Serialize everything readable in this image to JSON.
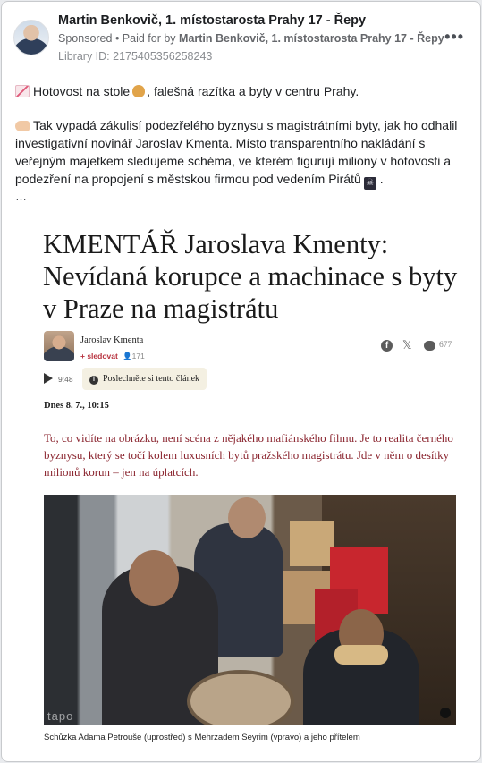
{
  "post": {
    "page_name": "Martin Benkovič, 1. místostarosta Prahy 17 - Řepy",
    "sponsored_label": "Sponsored",
    "separator": " • ",
    "paid_for_prefix": "Paid for by ",
    "paid_for_name": "Martin Benkovič, 1. místostarosta Prahy 17 - Řepy",
    "library_id": "Library ID: 2175405356258243",
    "more_icon": "•••",
    "text_p1_a": "Hotovost na stole",
    "text_p1_b": ", falešná razítka a byty v centru Prahy.",
    "text_p2_a": "Tak vypadá zákulisí podezřelého byznysu s magistrátními byty, jak ho odhalil investigativní novinář Jaroslav Kmenta. Místo transparentního nakládání s veřejným majetkem sledujeme schéma, ve kterém figurují miliony v hotovosti a podezření na propojení s městskou firmou pod vedením Pirátů",
    "text_p2_b": ".",
    "see_more": "…",
    "icons": [
      "chart-decreasing-emoji",
      "money-bag-emoji",
      "pointing-hand-emoji",
      "pirate-flag-emoji"
    ]
  },
  "article": {
    "title": "KMENTÁŘ Jaroslava Kmenty: Nevídaná korupce a machinace s byty v Praze na magistrátu",
    "author": "Jaroslav Kmenta",
    "follow_label": "+ sledovat",
    "followers": "171",
    "share_fb": "f",
    "share_x": "𝕏",
    "comments_count": "677",
    "audio_duration": "9:48",
    "listen_label": "Poslechněte si tento článek",
    "listen_icon": "i",
    "date": "Dnes 8. 7., 10:15",
    "lead": "To, co vidíte na obrázku, není scéna z nějakého mafiánského filmu. Je to realita černého byznysu, který se točí kolem luxusních bytů pražského magistrátu. Jde v něm o desítky milionů korun – jen na úplatcích.",
    "photo_watermark": "tapo",
    "caption": "Schůzka Adama Petrouše (uprostřed) s  Mehrzadem Seyrim (vpravo) a jeho přítelem"
  }
}
